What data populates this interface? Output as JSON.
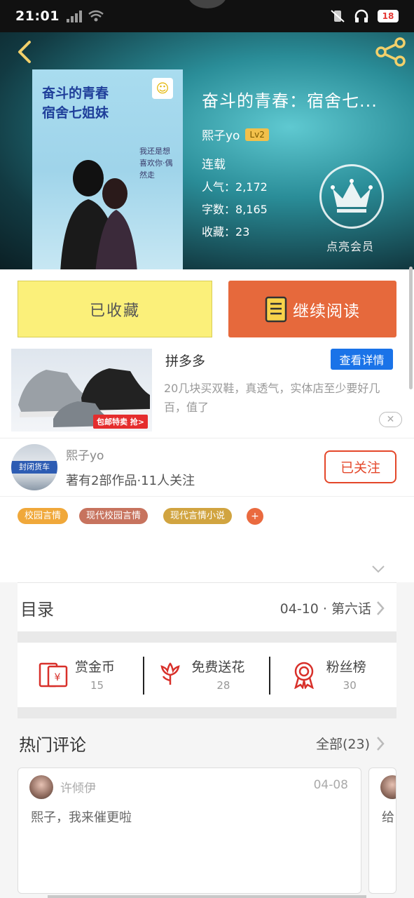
{
  "status_bar": {
    "time": "21:01",
    "battery": "18"
  },
  "book": {
    "title": "奋斗的青春：宿舍七...",
    "author": "熙子yo",
    "level": "Lv2",
    "status": "连载",
    "popularity_label": "人气：",
    "popularity": "2,172",
    "wordcount_label": "字数：",
    "wordcount": "8,165",
    "collections_label": "收藏：",
    "collections": "23",
    "cover_title_line1": "奋斗的青春",
    "cover_title_line2": "宿舍七姐妹"
  },
  "vip": {
    "label": "点亮会员"
  },
  "actions": {
    "favorite_label": "已收藏",
    "read_label": "继续阅读"
  },
  "ad": {
    "brand": "拼多多",
    "button": "查看详情",
    "description": "20几块买双鞋，真透气，实体店至少要好几百，值了",
    "image_tag": "包邮特卖 抢>"
  },
  "author_card": {
    "name": "熙子yo",
    "meta": "著有2部作品·11人关注",
    "follow_label": "已关注",
    "avatar_sign": "封闭货车"
  },
  "tags": [
    {
      "label": "校园言情",
      "color": "#f0a83a"
    },
    {
      "label": "现代校园言情",
      "color": "#c7735e"
    },
    {
      "label": "现代言情小说",
      "color": "#d1a440"
    }
  ],
  "tag_more": "+",
  "toc": {
    "label": "目录",
    "latest": "04-10 · 第六话"
  },
  "rewards": [
    {
      "title": "赏金币",
      "count": "15",
      "icon": "red-envelope-icon"
    },
    {
      "title": "免费送花",
      "count": "28",
      "icon": "flower-icon"
    },
    {
      "title": "粉丝榜",
      "count": "30",
      "icon": "medal-icon"
    }
  ],
  "comments": {
    "label": "热门评论",
    "all": "全部(23)",
    "items": [
      {
        "user": "许倾伊",
        "date": "04-08",
        "text": "熙子，我来催更啦"
      },
      {
        "user": "",
        "date": "",
        "text": "给"
      }
    ]
  },
  "colors": {
    "accent": "#e6693c",
    "favorite_bg": "#fbf07a",
    "follow": "#e4472a",
    "ad_button": "#1a73e8"
  }
}
